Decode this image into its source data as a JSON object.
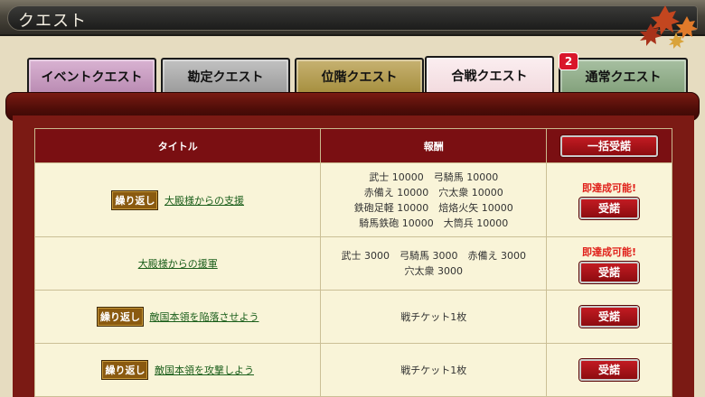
{
  "header": {
    "title": "クエスト"
  },
  "tabs": [
    {
      "label": "イベントクエスト"
    },
    {
      "label": "勘定クエスト"
    },
    {
      "label": "位階クエスト"
    },
    {
      "label": "合戦クエスト",
      "badge": "2",
      "active": true
    },
    {
      "label": "通常クエスト"
    }
  ],
  "table": {
    "headers": {
      "title": "タイトル",
      "reward": "報酬"
    },
    "bulk_accept": "一括受諾",
    "rows": [
      {
        "repeat": "繰り返し",
        "title": "大殿様からの支援",
        "reward_lines": [
          "武士 10000　弓騎馬 10000",
          "赤備え 10000　穴太衆 10000",
          "鉄砲足軽 10000　焙烙火矢 10000",
          "騎馬鉄砲 10000　大筒兵 10000"
        ],
        "ready": "即達成可能!",
        "accept": "受諾"
      },
      {
        "repeat": "",
        "title": "大殿様からの援軍",
        "reward_lines": [
          "武士 3000　弓騎馬 3000　赤備え 3000",
          "穴太衆 3000"
        ],
        "ready": "即達成可能!",
        "accept": "受諾"
      },
      {
        "repeat": "繰り返し",
        "title": "敵国本領を陥落させよう",
        "reward_lines": [
          "戦チケット1枚"
        ],
        "ready": "",
        "accept": "受諾"
      },
      {
        "repeat": "繰り返し",
        "title": "敵国本領を攻撃しよう",
        "reward_lines": [
          "戦チケット1枚"
        ],
        "ready": "",
        "accept": "受諾"
      }
    ]
  }
}
